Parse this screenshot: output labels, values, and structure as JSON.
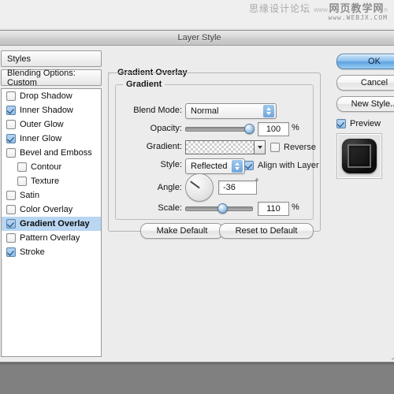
{
  "watermark": {
    "line1_cn": "思缘设计论坛",
    "line1_www": "www.",
    "line1_brand": "网页教学网",
    "line1_tail": "n",
    "line2": "www.WEBJX.COM"
  },
  "dialog": {
    "title": "Layer Style"
  },
  "styles_panel": {
    "styles_label": "Styles",
    "blending_label": "Blending Options: Custom",
    "effects": [
      {
        "label": "Drop Shadow",
        "checked": false,
        "indent": false,
        "selected": false
      },
      {
        "label": "Inner Shadow",
        "checked": true,
        "indent": false,
        "selected": false
      },
      {
        "label": "Outer Glow",
        "checked": false,
        "indent": false,
        "selected": false
      },
      {
        "label": "Inner Glow",
        "checked": true,
        "indent": false,
        "selected": false
      },
      {
        "label": "Bevel and Emboss",
        "checked": false,
        "indent": false,
        "selected": false
      },
      {
        "label": "Contour",
        "checked": false,
        "indent": true,
        "selected": false
      },
      {
        "label": "Texture",
        "checked": false,
        "indent": true,
        "selected": false
      },
      {
        "label": "Satin",
        "checked": false,
        "indent": false,
        "selected": false
      },
      {
        "label": "Color Overlay",
        "checked": false,
        "indent": false,
        "selected": false
      },
      {
        "label": "Gradient Overlay",
        "checked": true,
        "indent": false,
        "selected": true
      },
      {
        "label": "Pattern Overlay",
        "checked": false,
        "indent": false,
        "selected": false
      },
      {
        "label": "Stroke",
        "checked": true,
        "indent": false,
        "selected": false
      }
    ]
  },
  "gradient_overlay": {
    "section_title": "Gradient Overlay",
    "group_title": "Gradient",
    "blend_mode_label": "Blend Mode:",
    "blend_mode_value": "Normal",
    "opacity_label": "Opacity:",
    "opacity_value": "100",
    "opacity_unit": "%",
    "opacity_percent": 100,
    "gradient_label": "Gradient:",
    "reverse_label": "Reverse",
    "reverse_checked": false,
    "style_label": "Style:",
    "style_value": "Reflected",
    "align_label": "Align with Layer",
    "align_checked": true,
    "angle_label": "Angle:",
    "angle_value": "-36",
    "angle_unit": "°",
    "angle_degrees": -36,
    "scale_label": "Scale:",
    "scale_value": "110",
    "scale_unit": "%",
    "scale_percent": 55,
    "make_default_label": "Make Default",
    "reset_default_label": "Reset to Default"
  },
  "actions": {
    "ok_label": "OK",
    "cancel_label": "Cancel",
    "new_style_label": "New Style...",
    "preview_label": "Preview",
    "preview_checked": true
  },
  "colors": {
    "accent": "#6ea6db",
    "selection": "#b9d6f2",
    "dialog_bg": "#ececec",
    "desktop_bg": "#808080",
    "gradient_start": "#ffffff",
    "gradient_end": "#c9a8bd"
  }
}
